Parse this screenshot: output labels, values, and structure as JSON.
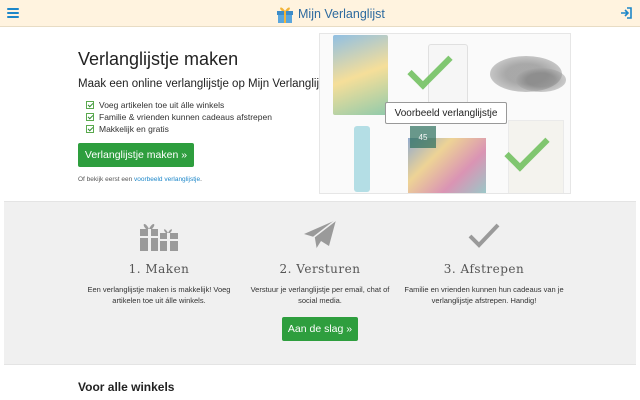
{
  "header": {
    "menu_icon": "hamburger-icon",
    "logo_icon": "gift-icon",
    "logo_text": "Mijn Verlanglijst",
    "login_icon": "login-icon",
    "background": "#fff3df",
    "accent": "#1d87c9"
  },
  "hero": {
    "title": "Verlanglijstje maken",
    "subtitle": "Maak een online verlanglijstje op Mijn Verlanglijst.",
    "features": [
      "Voeg artikelen toe uit álle winkels",
      "Familie & vrienden kunnen cadeaus afstrepen",
      "Makkelijk en gratis"
    ],
    "cta_label": "Verlanglijstje maken »",
    "example_prefix": "Of bekijk eerst een ",
    "example_link": "voorbeeld verlanglijstje",
    "example_suffix": ".",
    "button_color": "#2e9e3e"
  },
  "collage": {
    "label": "Voorbeeld verlanglijstje",
    "tag_text": "45"
  },
  "steps": [
    {
      "icon": "gifts-icon",
      "title": "1. Maken",
      "text": "Een verlanglijstje maken is makkelijk! Voeg artikelen toe uit álle winkels."
    },
    {
      "icon": "paper-plane-icon",
      "title": "2. Versturen",
      "text": "Verstuur je verlanglijstje per email, chat of social media."
    },
    {
      "icon": "checkmark-icon",
      "title": "3. Afstrepen",
      "text": "Familie en vrienden kunnen hun cadeaus van je verlanglijstje afstrepen. Handig!"
    }
  ],
  "start_button": "Aan de slag »",
  "section_heading": "Voor alle winkels"
}
